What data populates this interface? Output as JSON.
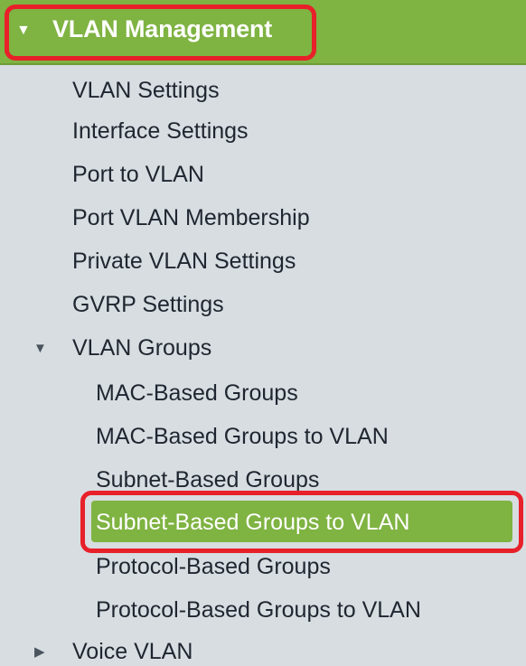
{
  "menu": {
    "section_title": "VLAN Management",
    "items": [
      {
        "label": "VLAN Settings"
      },
      {
        "label": "Interface Settings"
      },
      {
        "label": "Port to VLAN"
      },
      {
        "label": "Port VLAN Membership"
      },
      {
        "label": "Private VLAN Settings"
      },
      {
        "label": "GVRP Settings"
      }
    ],
    "groups": {
      "label": "VLAN Groups",
      "children": [
        {
          "label": "MAC-Based Groups"
        },
        {
          "label": "MAC-Based Groups to VLAN"
        },
        {
          "label": "Subnet-Based Groups"
        },
        {
          "label": "Subnet-Based Groups to VLAN",
          "selected": true
        },
        {
          "label": "Protocol-Based Groups"
        },
        {
          "label": "Protocol-Based Groups to VLAN"
        }
      ]
    },
    "voice": {
      "label": "Voice VLAN"
    }
  },
  "colors": {
    "accent_green": "#7fb342",
    "highlight_red": "#e8202a",
    "background": "#d7dde1"
  },
  "icons": {
    "expanded": "triangle-down-icon",
    "collapsed": "triangle-right-icon"
  }
}
